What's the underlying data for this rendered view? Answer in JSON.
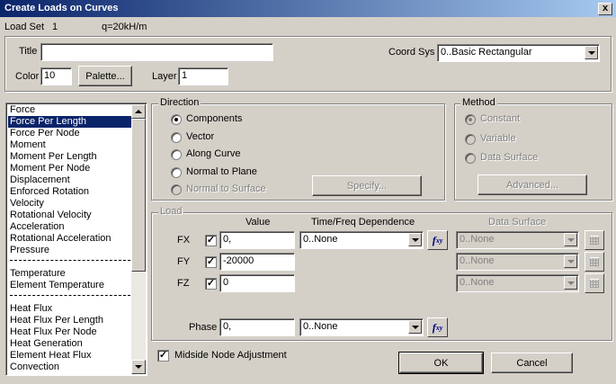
{
  "window": {
    "title": "Create Loads on Curves",
    "close": "x"
  },
  "header": {
    "load_set_label": "Load Set",
    "load_set_value": "1",
    "load_set_name": "q=20kH/m"
  },
  "title_field": {
    "label": "Title",
    "value": ""
  },
  "coord_sys": {
    "label": "Coord Sys",
    "value": "0..Basic Rectangular"
  },
  "color": {
    "label": "Color",
    "value": "10",
    "palette_button": "Palette..."
  },
  "layer": {
    "label": "Layer",
    "value": "1"
  },
  "load_types": {
    "group1": [
      "Force",
      "Force Per Length",
      "Force Per Node",
      "Moment",
      "Moment Per Length",
      "Moment Per Node",
      "Displacement",
      "Enforced Rotation",
      "Velocity",
      "Rotational Velocity",
      "Acceleration",
      "Rotational Acceleration",
      "Pressure"
    ],
    "group2": [
      "Temperature",
      "Element Temperature"
    ],
    "group3": [
      "Heat Flux",
      "Heat Flux Per Length",
      "Heat Flux Per Node",
      "Heat Generation",
      "Element Heat Flux",
      "Convection"
    ],
    "selected": "Force Per Length"
  },
  "direction": {
    "label": "Direction",
    "options": [
      "Components",
      "Vector",
      "Along Curve",
      "Normal to Plane",
      "Normal to Surface"
    ],
    "selected": "Components",
    "specify_button": "Specify..."
  },
  "method": {
    "label": "Method",
    "options": [
      "Constant",
      "Variable",
      "Data Surface"
    ],
    "selected": "Constant",
    "advanced_button": "Advanced..."
  },
  "load": {
    "label": "Load",
    "headers": {
      "value": "Value",
      "time_freq": "Time/Freq Dependence",
      "data_surface": "Data Surface"
    },
    "rows": [
      {
        "name": "FX",
        "checked": true,
        "value": "0,",
        "time_freq": "0..None",
        "data_surface": "0..None"
      },
      {
        "name": "FY",
        "checked": true,
        "value": "-20000",
        "data_surface": "0..None"
      },
      {
        "name": "FZ",
        "checked": true,
        "value": "0",
        "data_surface": "0..None"
      }
    ],
    "phase": {
      "label": "Phase",
      "value": "0,",
      "time_freq": "0..None"
    },
    "fxy_label": "f",
    "fxy_sub": "xy"
  },
  "midside": {
    "label": "Midside Node Adjustment",
    "checked": true
  },
  "buttons": {
    "ok": "OK",
    "cancel": "Cancel"
  },
  "check_mark": "✓"
}
